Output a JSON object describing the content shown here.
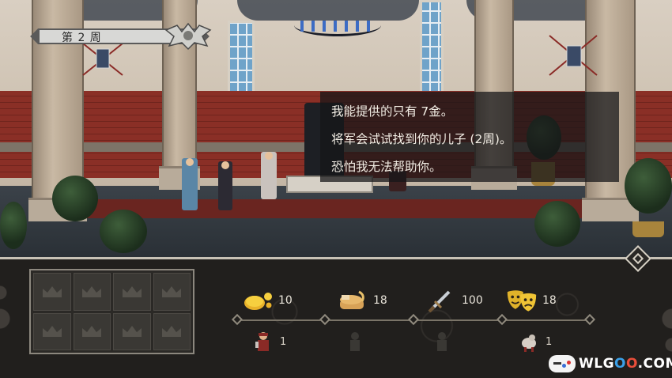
{
  "week_banner": {
    "label": "第 2 周"
  },
  "dialogue": {
    "lines": [
      "我能提供的只有 7金。",
      "将军会试试找到你的儿子 (2周)。",
      "恐怕我无法帮助你。"
    ]
  },
  "resources": [
    {
      "name": "gold",
      "icon": "gold-coins-icon",
      "value": "10",
      "color": "#e8b12a"
    },
    {
      "name": "food",
      "icon": "food-bread-icon",
      "value": "18",
      "color": "#d7a257"
    },
    {
      "name": "army",
      "icon": "sword-icon",
      "value": "100",
      "color": "#9aa3ad"
    },
    {
      "name": "morale",
      "icon": "theater-masks-icon",
      "value": "18",
      "color": "#e0b22a"
    }
  ],
  "population": [
    {
      "name": "soldiers",
      "icon": "soldier-icon",
      "value": "1"
    },
    {
      "name": "slot-2",
      "icon": "shadow-figure-icon",
      "value": ""
    },
    {
      "name": "slot-3",
      "icon": "shadow-figure-icon",
      "value": ""
    },
    {
      "name": "companion",
      "icon": "pig-figure-icon",
      "value": "1"
    }
  ],
  "crown_slots": {
    "count": 8,
    "icon": "crown-icon"
  },
  "watermark": {
    "text_a": "WLG",
    "text_o1": "O",
    "text_o2": "O",
    "text_b": ".COM"
  }
}
